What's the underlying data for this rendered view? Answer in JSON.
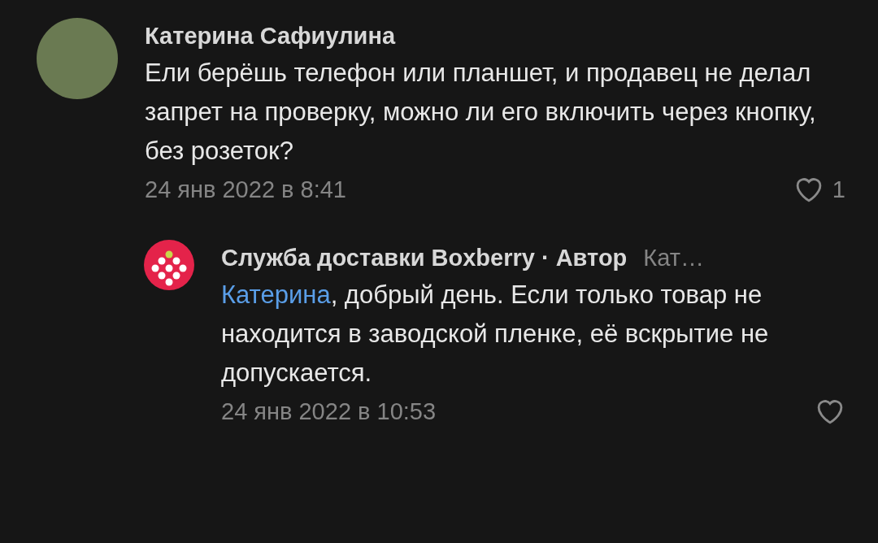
{
  "comment": {
    "author": "Катерина Сафиулина",
    "text": "Ели берёшь телефон или планшет, и продавец не делал запрет на проверку, можно ли его включить через кнопку, без розеток?",
    "date": "24 янв 2022 в 8:41",
    "likes": "1"
  },
  "reply": {
    "author": "Служба доставки Boxberry",
    "badge": "· Автор",
    "reply_to": "Кат…",
    "mention": "Катерина",
    "text": ", добрый день. Если только товар не находится в заводской пленке, её вскрытие не допускается.",
    "date": "24 янв 2022 в 10:53"
  }
}
